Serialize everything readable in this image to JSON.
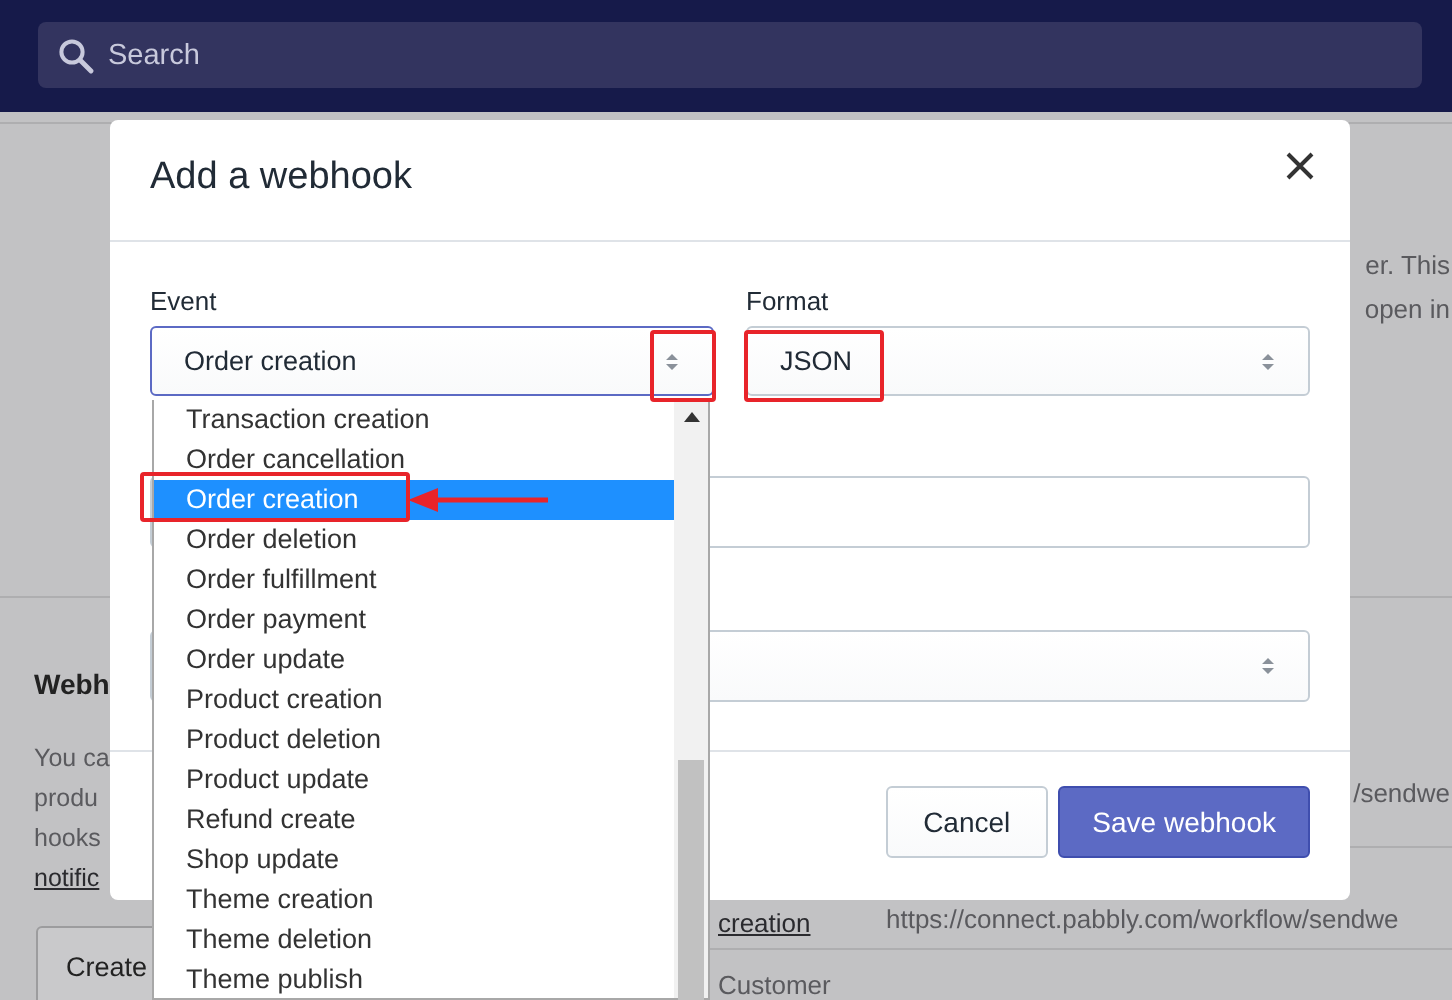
{
  "topbar": {
    "search": {
      "placeholder": "Search"
    }
  },
  "background": {
    "fragments": [
      {
        "text": "er. This",
        "kind": "plain"
      },
      {
        "text": "open in",
        "kind": "plain"
      },
      {
        "text": "Webh",
        "kind": "heading"
      },
      {
        "text": "You ca",
        "kind": "plain"
      },
      {
        "text": "/sendwe",
        "kind": "plain"
      },
      {
        "text": "produ",
        "kind": "plain"
      },
      {
        "text": "hooks",
        "kind": "plain"
      },
      {
        "text": "notific",
        "kind": "link"
      },
      {
        "text": "creation",
        "kind": "link"
      },
      {
        "text": "https://connect.pabbly.com/workflow/sendwe",
        "kind": "plain"
      },
      {
        "text": "Customer",
        "kind": "plain"
      }
    ],
    "create_button": "Create"
  },
  "modal": {
    "title": "Add a webhook",
    "event": {
      "label": "Event",
      "value": "Order creation",
      "expanded": true
    },
    "format": {
      "label": "Format",
      "value": "JSON"
    },
    "options": [
      {
        "label": "Transaction creation",
        "selected": false
      },
      {
        "label": "Order cancellation",
        "selected": false
      },
      {
        "label": "Order creation",
        "selected": true
      },
      {
        "label": "Order deletion",
        "selected": false
      },
      {
        "label": "Order fulfillment",
        "selected": false
      },
      {
        "label": "Order payment",
        "selected": false
      },
      {
        "label": "Order update",
        "selected": false
      },
      {
        "label": "Product creation",
        "selected": false
      },
      {
        "label": "Product deletion",
        "selected": false
      },
      {
        "label": "Product update",
        "selected": false
      },
      {
        "label": "Refund create",
        "selected": false
      },
      {
        "label": "Shop update",
        "selected": false
      },
      {
        "label": "Theme creation",
        "selected": false
      },
      {
        "label": "Theme deletion",
        "selected": false
      },
      {
        "label": "Theme publish",
        "selected": false
      }
    ],
    "buttons": [
      {
        "label": "Cancel",
        "kind": "secondary"
      },
      {
        "label": "Save webhook",
        "kind": "primary"
      }
    ]
  }
}
